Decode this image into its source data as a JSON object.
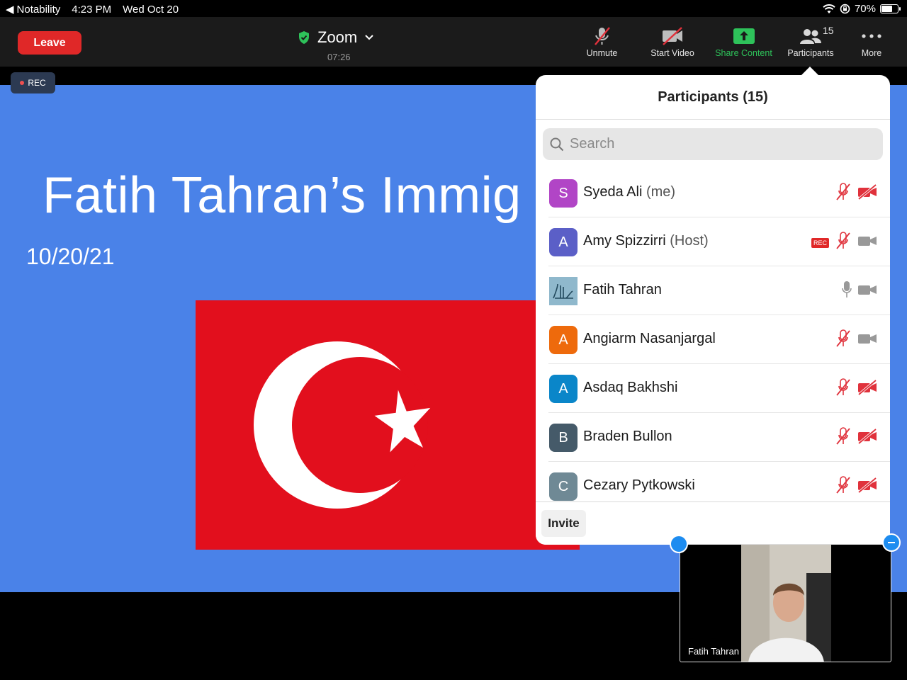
{
  "status_bar": {
    "back_app": "Notability",
    "time": "4:23 PM",
    "date": "Wed Oct 20",
    "battery": "70%",
    "battery_level": 0.7
  },
  "toolbar": {
    "leave_label": "Leave",
    "meeting_title": "Zoom",
    "meeting_time": "07:26",
    "unmute_label": "Unmute",
    "start_video_label": "Start Video",
    "share_label": "Share Content",
    "participants_label": "Participants",
    "participants_count": "15",
    "more_label": "More"
  },
  "colors": {
    "leave": "#e02828",
    "share": "#2ec25a",
    "slide_bg": "#4a82e8",
    "flag_red": "#e20f1d",
    "muted_icon": "#e0323c"
  },
  "slide": {
    "rec_label": "REC",
    "title": "Fatih Tahran’s Immig",
    "date": "10/20/21"
  },
  "participants_panel": {
    "title": "Participants (15)",
    "search_placeholder": "Search",
    "invite_label": "Invite",
    "rec_tag": "REC",
    "items": [
      {
        "initial": "S",
        "name": "Syeda Ali",
        "role": "(me)",
        "color": "#b145c6",
        "audio": "muted",
        "video": "off"
      },
      {
        "initial": "A",
        "name": "Amy Spizzirri",
        "role": "(Host)",
        "color": "#5b5fc7",
        "audio": "muted",
        "video": "on",
        "recording": true
      },
      {
        "initial": "",
        "name": "Fatih Tahran",
        "role": "",
        "color": "#8fb8cc",
        "audio": "on",
        "video": "on",
        "avatar": "calligraphy-image"
      },
      {
        "initial": "A",
        "name": "Angiarm Nasanjargal",
        "role": "",
        "color": "#ee6a0c",
        "audio": "muted",
        "video": "on"
      },
      {
        "initial": "A",
        "name": "Asdaq Bakhshi",
        "role": "",
        "color": "#0a86c9",
        "audio": "muted",
        "video": "off"
      },
      {
        "initial": "B",
        "name": "Braden Bullon",
        "role": "",
        "color": "#455a69",
        "audio": "muted",
        "video": "off"
      },
      {
        "initial": "C",
        "name": "Cezary Pytkowski",
        "role": "",
        "color": "#6f8995",
        "audio": "muted",
        "video": "off"
      }
    ]
  },
  "video_thumbnail": {
    "name": "Fatih Tahran"
  }
}
